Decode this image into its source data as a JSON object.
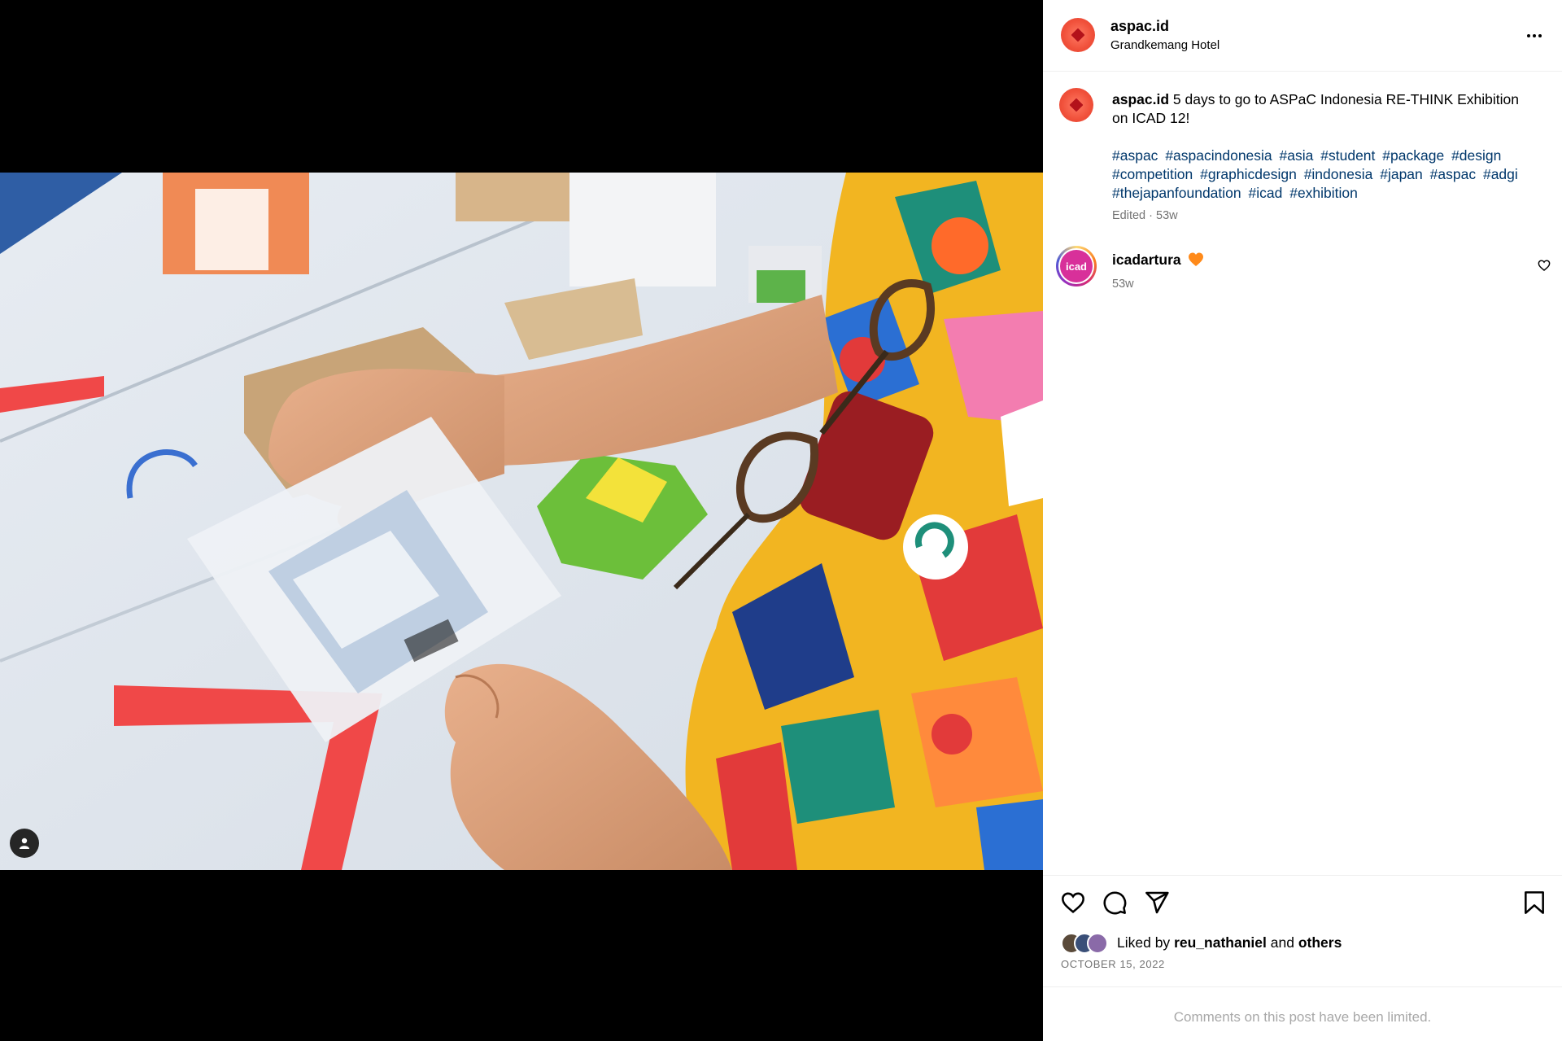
{
  "post": {
    "username": "aspac.id",
    "location": "Grandkemang Hotel",
    "caption_text": "5 days to go to ASPaC Indonesia RE-THINK Exhibition on ICAD 12!",
    "hashtags": [
      "#aspac",
      "#aspacindonesia",
      "#asia",
      "#student",
      "#package",
      "#design",
      "#competition",
      "#graphicdesign",
      "#indonesia",
      "#japan",
      "#aspac",
      "#adgi",
      "#thejapanfoundation",
      "#icad",
      "#exhibition"
    ],
    "meta": "Edited · 53w"
  },
  "comment": {
    "username": "icadartura",
    "avatar_text": "icad",
    "time": "53w",
    "emoji_icon": "orange-heart-icon"
  },
  "likes": {
    "prefix": "Liked by",
    "user": "reu_nathaniel",
    "joiner": "and",
    "others": "others"
  },
  "date": "OCTOBER 15, 2022",
  "comments_notice": "Comments on this post have been limited.",
  "icons": {
    "more": "more-options-icon",
    "like": "heart-icon",
    "comment": "comment-icon",
    "share": "share-icon",
    "save": "bookmark-icon",
    "tag": "user-tag-icon"
  },
  "colors": {
    "brand": "#f0503a",
    "hashtag": "#00376b",
    "muted": "#737373"
  }
}
